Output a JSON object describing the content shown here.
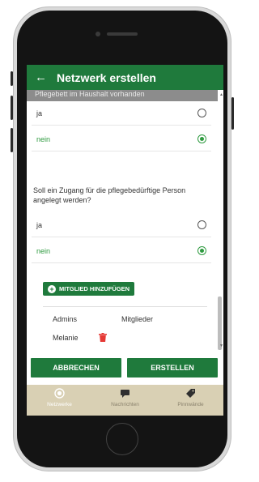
{
  "appbar": {
    "back_icon": "arrow-left-icon",
    "title": "Netzwerk erstellen"
  },
  "section1": {
    "cut_header": "Pflegebett im Haushalt vorhanden",
    "options": [
      {
        "label": "ja",
        "selected": false
      },
      {
        "label": "nein",
        "selected": true
      }
    ]
  },
  "section2": {
    "question": "Soll ein Zugang für die pflegebedürftige Person angelegt werden?",
    "options": [
      {
        "label": "ja",
        "selected": false
      },
      {
        "label": "nein",
        "selected": true
      }
    ]
  },
  "add_member_button": "MITGLIED HINZUFÜGEN",
  "members": {
    "admins_header": "Admins",
    "members_header": "Mitglieder",
    "admins": [
      {
        "name": "Melanie",
        "icon": "trash-icon"
      }
    ]
  },
  "actions": {
    "cancel": "ABBRECHEN",
    "create": "ERSTELLEN"
  },
  "bottom_nav": [
    {
      "label": "Netzwerke",
      "icon": "network-icon",
      "active": true
    },
    {
      "label": "Nachrichten",
      "icon": "chat-icon",
      "active": false
    },
    {
      "label": "Pinnwände",
      "icon": "tag-icon",
      "active": false
    }
  ],
  "colors": {
    "primary": "#1f7a3c",
    "accent_green": "#2e9a3f",
    "nav_bg": "#d9d0b4",
    "delete_red": "#e53935"
  }
}
